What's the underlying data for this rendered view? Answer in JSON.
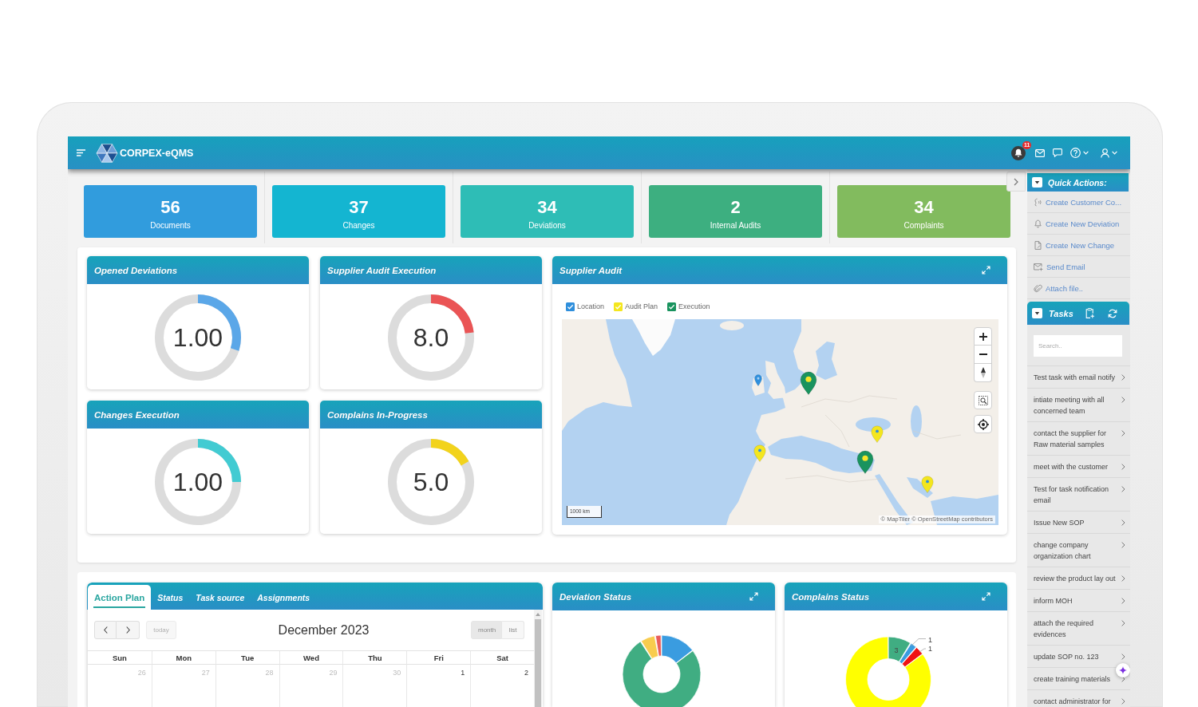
{
  "header": {
    "brand": "CORPEX-eQMS",
    "notifications": "11"
  },
  "kpis": [
    {
      "value": "56",
      "label": "Documents",
      "color": "#319cdd"
    },
    {
      "value": "37",
      "label": "Changes",
      "color": "#14b5d1"
    },
    {
      "value": "34",
      "label": "Deviations",
      "color": "#2ebdb6"
    },
    {
      "value": "2",
      "label": "Internal Audits",
      "color": "#3daf80"
    },
    {
      "value": "34",
      "label": "Complaints",
      "color": "#82bb5e"
    }
  ],
  "gauges": [
    {
      "title": "Opened Deviations",
      "value": "1.00",
      "level": 0.3,
      "color": "#5ba7e8"
    },
    {
      "title": "Supplier Audit Execution",
      "value": "8.0",
      "level": 0.23,
      "color": "#ea5455"
    },
    {
      "title": "Changes Execution",
      "value": "1.00",
      "level": 0.25,
      "color": "#42cbd2"
    },
    {
      "title": "Complains In-Progress",
      "value": "5.0",
      "level": 0.17,
      "color": "#f2d31c"
    }
  ],
  "supplier_audit": {
    "title": "Supplier Audit",
    "filters": [
      {
        "label": "Location",
        "checked": true,
        "color": "#2f8fdc"
      },
      {
        "label": "Audit Plan",
        "checked": true,
        "color": "#f4e61e"
      },
      {
        "label": "Execution",
        "checked": true,
        "color": "#19935e"
      }
    ],
    "markers": [
      {
        "kind": "location",
        "color": "#2f8fdc"
      },
      {
        "kind": "execution",
        "color": "#19935e"
      },
      {
        "kind": "plan",
        "color": "#f4e61e"
      },
      {
        "kind": "plan",
        "color": "#f4e61e"
      },
      {
        "kind": "execution",
        "color": "#19935e"
      },
      {
        "kind": "plan",
        "color": "#f4e61e"
      }
    ],
    "scale": "1000 km",
    "attribution": "© MapTiler © OpenStreetMap contributors"
  },
  "action_plan": {
    "tabs": [
      {
        "label": "Action Plan",
        "selected": true
      },
      {
        "label": "Status",
        "selected": false
      },
      {
        "label": "Task source",
        "selected": false
      },
      {
        "label": "Assignments",
        "selected": false
      }
    ],
    "calendar": {
      "title": "December 2023",
      "today": {
        "label": "today",
        "disabled": true
      },
      "views": [
        {
          "label": "month",
          "selected": true
        },
        {
          "label": "list",
          "selected": false
        }
      ],
      "weekdays": [
        "Sun",
        "Mon",
        "Tue",
        "Wed",
        "Thu",
        "Fri",
        "Sat"
      ],
      "days": [
        {
          "label": "26",
          "other_month": true
        },
        {
          "label": "27",
          "other_month": true
        },
        {
          "label": "28",
          "other_month": true
        },
        {
          "label": "29",
          "other_month": true
        },
        {
          "label": "30",
          "other_month": true
        },
        {
          "label": "1",
          "other_month": false
        },
        {
          "label": "2",
          "other_month": false
        }
      ]
    }
  },
  "deviation_status": {
    "title": "Deviation Status"
  },
  "complains_status": {
    "title": "Complains Status",
    "slice_labels": [
      "3",
      "1",
      "1"
    ]
  },
  "quick_actions": {
    "title": "Quick Actions:",
    "items": [
      {
        "kind": "complaint",
        "label": "Create Customer Co..."
      },
      {
        "kind": "deviation",
        "label": "Create New Deviation"
      },
      {
        "kind": "change",
        "label": "Create New Change"
      },
      {
        "kind": "email",
        "label": "Send Email"
      },
      {
        "kind": "attachment",
        "label": "Attach file.."
      }
    ]
  },
  "tasks": {
    "title": "Tasks",
    "search": {
      "placeholder": "Search.."
    },
    "items": [
      "Test task with email notify",
      "intiate meeting with all concerned team",
      "contact the supplier for Raw material samples",
      "meet with the customer",
      "Test for task notification email",
      "Issue New SOP",
      "change company organization chart",
      "review the product lay out",
      "inform MOH",
      "attach the required evidences",
      "update SOP no. 123",
      "create training materials",
      "contact administrator for"
    ]
  }
}
